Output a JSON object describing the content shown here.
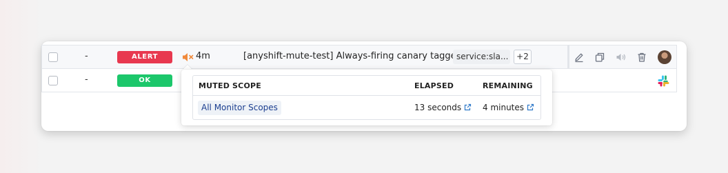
{
  "rows": [
    {
      "dash": "-",
      "status": "ALERT",
      "mute_time": "4m",
      "name": "[anyshift-mute-test] Always-firing canary tagged",
      "tag": "service:sla...",
      "tag_more": "+2"
    },
    {
      "dash": "-",
      "status": "OK"
    }
  ],
  "popover": {
    "headers": {
      "scope": "MUTED SCOPE",
      "elapsed": "ELAPSED",
      "remaining": "REMAINING"
    },
    "row": {
      "scope": "All Monitor Scopes",
      "elapsed": "13 seconds",
      "remaining": "4 minutes"
    }
  },
  "colors": {
    "alert": "#e8384f",
    "ok": "#1cc76b",
    "mute_icon": "#f08a3c",
    "link": "#2d78c8"
  },
  "icons": {
    "mute": "speaker-muted-icon",
    "edit": "pencil-icon",
    "clone": "copy-icon",
    "mute_action": "speaker-icon",
    "delete": "trash-icon",
    "external": "external-link-icon",
    "slack": "slack-icon"
  }
}
